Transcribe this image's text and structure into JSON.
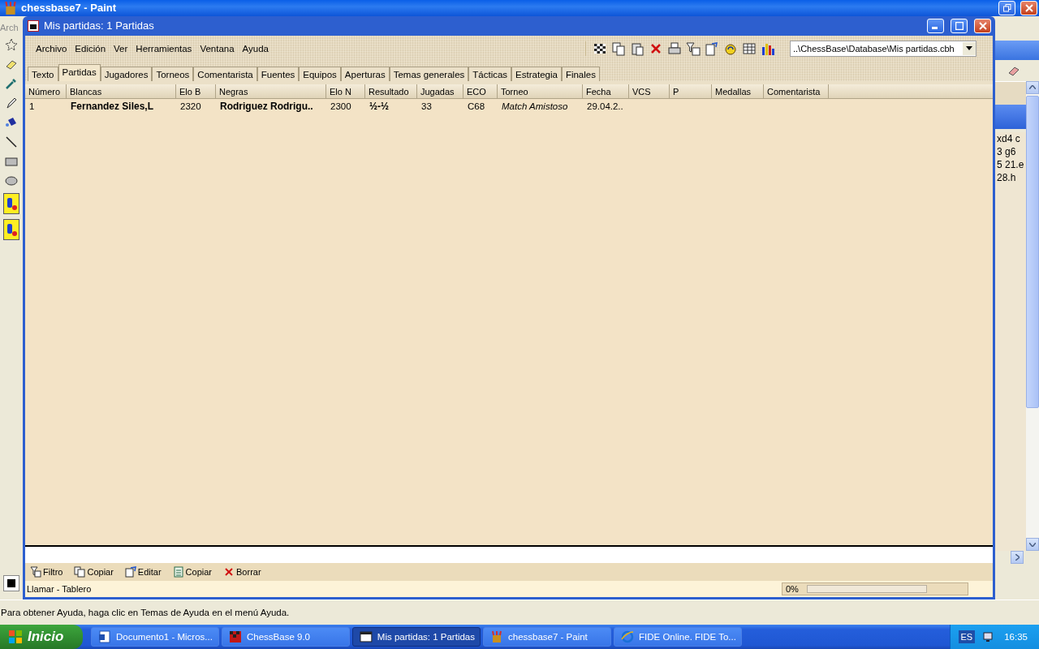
{
  "paint": {
    "title": "chessbase7 - Paint",
    "menu_fragment": "Arch",
    "side_text": [
      "xd4  c",
      "3  g6",
      "5  21.e",
      "28.h"
    ],
    "status": "Para obtener Ayuda, haga clic en Temas de Ayuda en el menú Ayuda."
  },
  "window": {
    "title": "Mis partidas:  1 Partidas",
    "menu": [
      "Archivo",
      "Edición",
      "Ver",
      "Herramientas",
      "Ventana",
      "Ayuda"
    ],
    "database_path": "..\\ChessBase\\Database\\Mis partidas.cbh"
  },
  "tabs": [
    {
      "label": "Texto",
      "selected": false
    },
    {
      "label": "Partidas",
      "selected": true
    },
    {
      "label": "Jugadores",
      "selected": false
    },
    {
      "label": "Torneos",
      "selected": false
    },
    {
      "label": "Comentarista",
      "selected": false
    },
    {
      "label": "Fuentes",
      "selected": false
    },
    {
      "label": "Equipos",
      "selected": false
    },
    {
      "label": "Aperturas",
      "selected": false
    },
    {
      "label": "Temas generales",
      "selected": false
    },
    {
      "label": "Tácticas",
      "selected": false
    },
    {
      "label": "Estrategia",
      "selected": false
    },
    {
      "label": "Finales",
      "selected": false
    }
  ],
  "table": {
    "columns": [
      {
        "label": "Número",
        "kind": "plain"
      },
      {
        "label": "Blancas",
        "kind": "bold"
      },
      {
        "label": "Elo B",
        "kind": "plain"
      },
      {
        "label": "Negras",
        "kind": "bold"
      },
      {
        "label": "Elo N",
        "kind": "plain"
      },
      {
        "label": "Resultado",
        "kind": "bold"
      },
      {
        "label": "Jugadas",
        "kind": "plain"
      },
      {
        "label": "ECO",
        "kind": "plain"
      },
      {
        "label": "Torneo",
        "kind": "italic"
      },
      {
        "label": "Fecha",
        "kind": "plain"
      },
      {
        "label": "VCS",
        "kind": "plain"
      },
      {
        "label": "P",
        "kind": "plain"
      },
      {
        "label": "Medallas",
        "kind": "plain"
      },
      {
        "label": "Comentarista",
        "kind": "plain"
      }
    ],
    "rows": [
      [
        "1",
        "Fernandez Siles,L",
        "2320",
        "Rodriguez Rodrigu..",
        "2300",
        "½-½",
        "33",
        "C68",
        "Match Amistoso",
        "29.04.2.."
      ]
    ]
  },
  "bottom_toolbar": [
    {
      "label": "Filtro",
      "kind": "filter"
    },
    {
      "label": "Copiar",
      "kind": "copy"
    },
    {
      "label": "Editar",
      "kind": "edit"
    },
    {
      "label": "Copiar",
      "kind": "clipboard"
    },
    {
      "label": "Borrar",
      "kind": "delete"
    }
  ],
  "status_bar": {
    "text": "Llamar - Tablero",
    "progress": {
      "reading": "0%",
      "level": 0
    }
  },
  "taskbar": {
    "start": "Inicio",
    "items": [
      {
        "label": "Documento1 - Micros...",
        "kind": "document",
        "selected": false
      },
      {
        "label": "ChessBase 9.0",
        "kind": "chess",
        "selected": false
      },
      {
        "label": "Mis partidas:  1 Partidas",
        "kind": "window",
        "selected": true
      },
      {
        "label": "chessbase7 - Paint",
        "kind": "paint",
        "selected": false
      },
      {
        "label": "FIDE Online. FIDE To...",
        "kind": "browser",
        "selected": false
      }
    ],
    "language": "ES",
    "clock": "16:35"
  }
}
